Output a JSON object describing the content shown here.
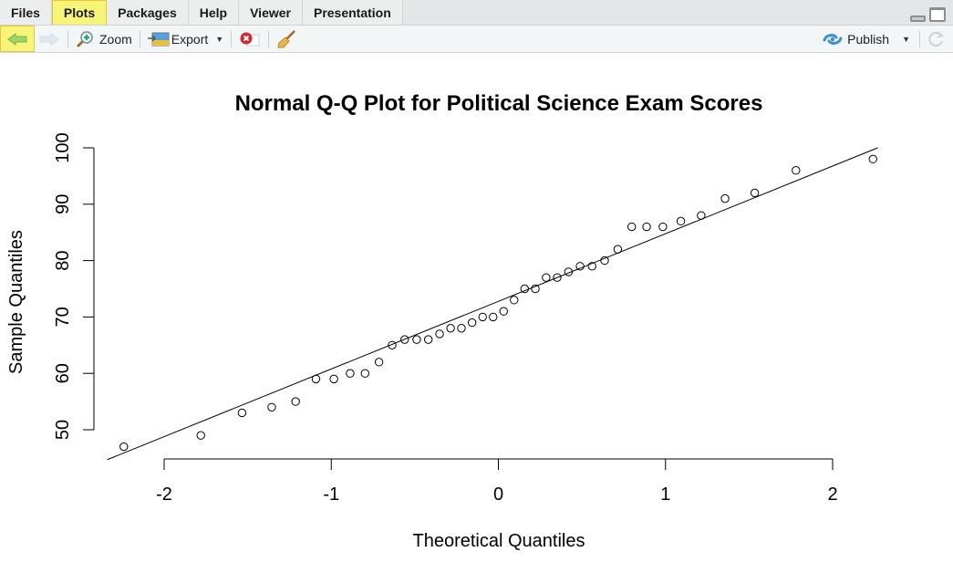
{
  "tabs": [
    {
      "label": "Files",
      "active": false
    },
    {
      "label": "Plots",
      "active": true
    },
    {
      "label": "Packages",
      "active": false
    },
    {
      "label": "Help",
      "active": false
    },
    {
      "label": "Viewer",
      "active": false
    },
    {
      "label": "Presentation",
      "active": false
    }
  ],
  "toolbar": {
    "back_icon": "arrow-left-icon",
    "forward_icon": "arrow-right-icon",
    "zoom_label": "Zoom",
    "export_label": "Export",
    "remove_icon": "remove-plot-icon",
    "clear_icon": "broom-icon",
    "publish_label": "Publish",
    "refresh_icon": "refresh-icon"
  },
  "chart_data": {
    "type": "scatter",
    "title": "Normal Q-Q Plot for Political Science Exam Scores",
    "xlabel": "Theoretical Quantiles",
    "ylabel": "Sample Quantiles",
    "xlim": [
      -2.3,
      2.3
    ],
    "ylim": [
      45,
      100
    ],
    "x_ticks": [
      -2,
      -1,
      0,
      1,
      2
    ],
    "x_tick_labels": [
      "-2",
      "-1",
      "0",
      "1",
      "2"
    ],
    "y_ticks": [
      50,
      60,
      70,
      80,
      90,
      100
    ],
    "y_tick_labels": [
      "50",
      "60",
      "70",
      "80",
      "90",
      "100"
    ],
    "grid": false,
    "legend": "none",
    "sample_values": [
      47,
      49,
      53,
      54,
      55,
      59,
      59,
      60,
      60,
      62,
      65,
      66,
      66,
      66,
      67,
      68,
      68,
      69,
      70,
      70,
      71,
      73,
      75,
      75,
      77,
      77,
      78,
      79,
      79,
      80,
      82,
      86,
      86,
      86,
      87,
      88,
      91,
      92,
      96,
      98
    ],
    "reference_line": {
      "x": [
        -2.34,
        2.27
      ],
      "y": [
        44.7,
        100
      ]
    }
  }
}
